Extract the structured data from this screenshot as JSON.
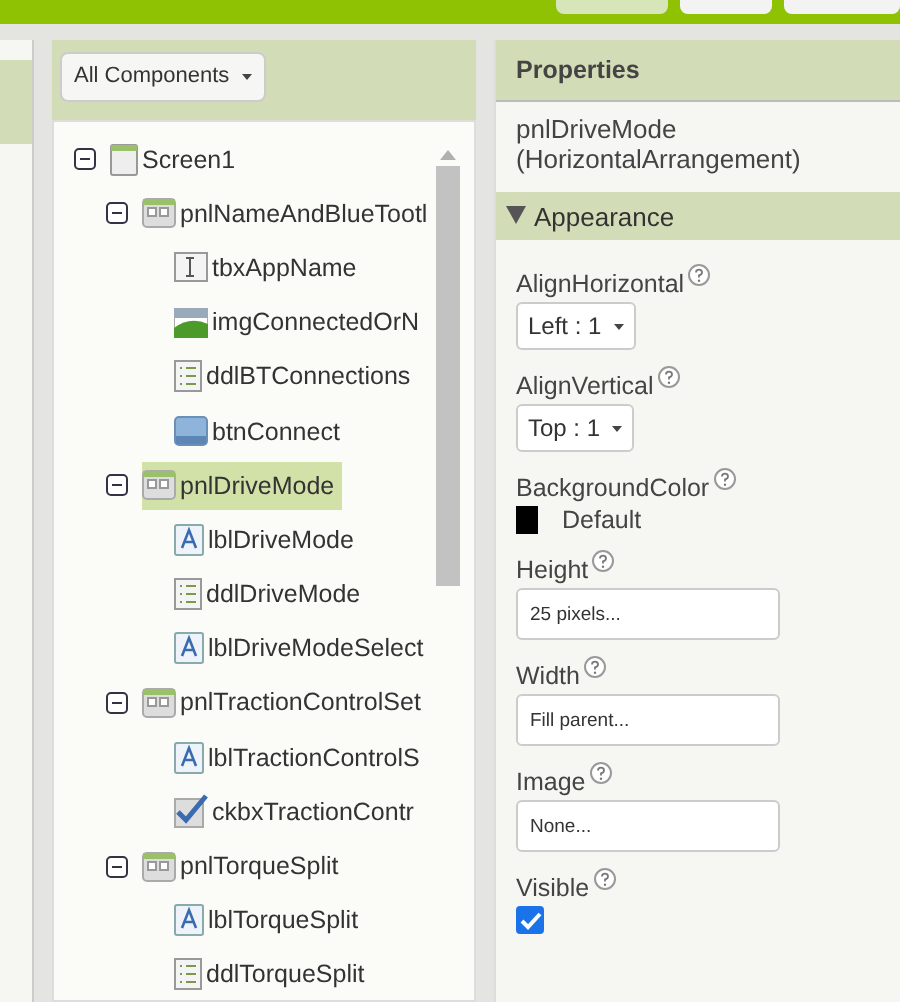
{
  "toolbar": {
    "buttons": [
      {
        "kind": "plain"
      },
      {
        "kind": "plain"
      },
      {
        "kind": "plain"
      }
    ]
  },
  "components": {
    "filter": "All Components",
    "tree": [
      {
        "name": "Screen1",
        "kind": "screen",
        "expanded": true,
        "selected": false,
        "children": [
          {
            "name": "pnlNameAndBlueTootl",
            "kind": "arrangement",
            "expanded": true,
            "selected": false,
            "children": [
              {
                "name": "tbxAppName",
                "kind": "textbox",
                "selected": false
              },
              {
                "name": "imgConnectedOrN",
                "kind": "image",
                "selected": false
              },
              {
                "name": "ddlBTConnections",
                "kind": "list",
                "selected": false
              },
              {
                "name": "btnConnect",
                "kind": "button",
                "selected": false
              }
            ]
          },
          {
            "name": "pnlDriveMode",
            "kind": "arrangement",
            "expanded": true,
            "selected": true,
            "children": [
              {
                "name": "lblDriveMode",
                "kind": "label",
                "selected": false
              },
              {
                "name": "ddlDriveMode",
                "kind": "list",
                "selected": false
              },
              {
                "name": "lblDriveModeSelect",
                "kind": "label",
                "selected": false
              }
            ]
          },
          {
            "name": "pnlTractionControlSet",
            "kind": "arrangement",
            "expanded": true,
            "selected": false,
            "children": [
              {
                "name": "lblTractionControlS",
                "kind": "label",
                "selected": false
              },
              {
                "name": "ckbxTractionContr",
                "kind": "checkbox",
                "selected": false
              }
            ]
          },
          {
            "name": "pnlTorqueSplit",
            "kind": "arrangement",
            "expanded": true,
            "selected": false,
            "children": [
              {
                "name": "lblTorqueSplit",
                "kind": "label",
                "selected": false
              },
              {
                "name": "ddlTorqueSplit",
                "kind": "list",
                "selected": false
              }
            ]
          }
        ]
      }
    ]
  },
  "properties": {
    "title": "Properties",
    "component": "pnlDriveMode (HorizontalArrangement)",
    "section": {
      "title": "Appearance",
      "expanded": true
    },
    "items": [
      {
        "label": "AlignHorizontal",
        "kind": "dropdown",
        "value": "Left : 1"
      },
      {
        "label": "AlignVertical",
        "kind": "dropdown",
        "value": "Top : 1"
      },
      {
        "label": "BackgroundColor",
        "kind": "color",
        "value": "Default",
        "color": "#000000"
      },
      {
        "label": "Height",
        "kind": "textbox",
        "value": "25 pixels..."
      },
      {
        "label": "Width",
        "kind": "textbox",
        "value": "Fill parent..."
      },
      {
        "label": "Image",
        "kind": "textbox",
        "value": "None..."
      },
      {
        "label": "Visible",
        "kind": "checkbox",
        "checked": true
      }
    ]
  }
}
